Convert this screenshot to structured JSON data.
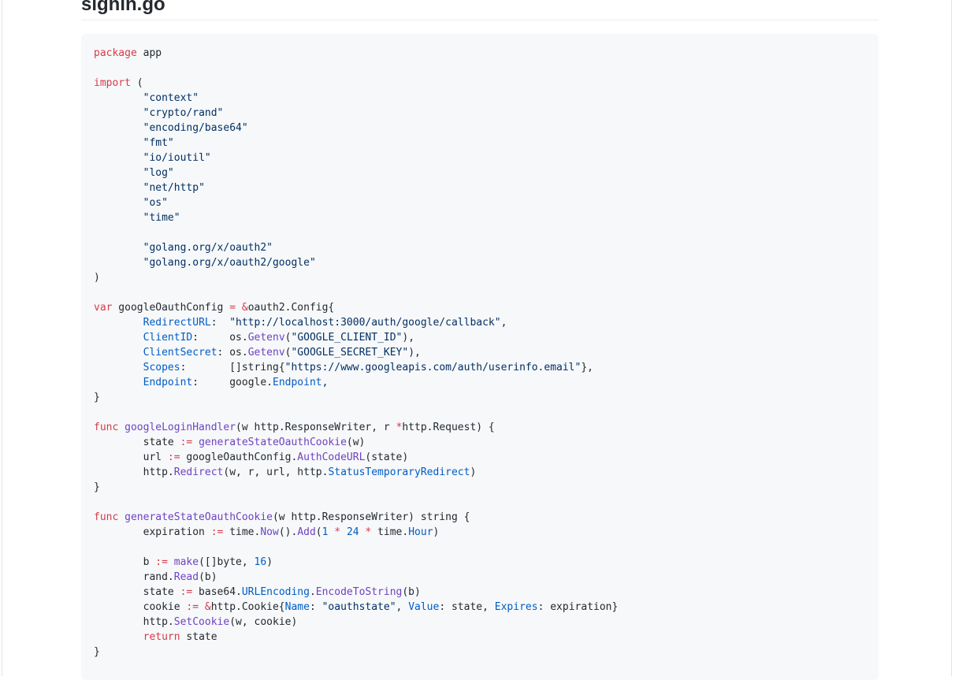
{
  "file": {
    "title": "signin.go"
  },
  "colors": {
    "keyword": "#d73a49",
    "string": "#032f62",
    "function": "#6f42c1",
    "field": "#005cc5",
    "text": "#24292e",
    "code_bg": "#f6f8fa"
  },
  "code_lines": [
    [
      [
        "kw",
        "package"
      ],
      [
        "plain",
        " app"
      ]
    ],
    [],
    [
      [
        "kw",
        "import"
      ],
      [
        "plain",
        " ("
      ]
    ],
    [
      [
        "plain",
        "        "
      ],
      [
        "str",
        "\"context\""
      ]
    ],
    [
      [
        "plain",
        "        "
      ],
      [
        "str",
        "\"crypto/rand\""
      ]
    ],
    [
      [
        "plain",
        "        "
      ],
      [
        "str",
        "\"encoding/base64\""
      ]
    ],
    [
      [
        "plain",
        "        "
      ],
      [
        "str",
        "\"fmt\""
      ]
    ],
    [
      [
        "plain",
        "        "
      ],
      [
        "str",
        "\"io/ioutil\""
      ]
    ],
    [
      [
        "plain",
        "        "
      ],
      [
        "str",
        "\"log\""
      ]
    ],
    [
      [
        "plain",
        "        "
      ],
      [
        "str",
        "\"net/http\""
      ]
    ],
    [
      [
        "plain",
        "        "
      ],
      [
        "str",
        "\"os\""
      ]
    ],
    [
      [
        "plain",
        "        "
      ],
      [
        "str",
        "\"time\""
      ]
    ],
    [],
    [
      [
        "plain",
        "        "
      ],
      [
        "str",
        "\"golang.org/x/oauth2\""
      ]
    ],
    [
      [
        "plain",
        "        "
      ],
      [
        "str",
        "\"golang.org/x/oauth2/google\""
      ]
    ],
    [
      [
        "plain",
        ")"
      ]
    ],
    [],
    [
      [
        "kw",
        "var"
      ],
      [
        "plain",
        " googleOauthConfig "
      ],
      [
        "op",
        "="
      ],
      [
        "plain",
        " "
      ],
      [
        "op",
        "&"
      ],
      [
        "plain",
        "oauth2.Config{"
      ]
    ],
    [
      [
        "plain",
        "        "
      ],
      [
        "field",
        "RedirectURL"
      ],
      [
        "plain",
        ":  "
      ],
      [
        "str",
        "\"http://localhost:3000/auth/google/callback\""
      ],
      [
        "plain",
        ","
      ]
    ],
    [
      [
        "plain",
        "        "
      ],
      [
        "field",
        "ClientID"
      ],
      [
        "plain",
        ":     os."
      ],
      [
        "fn",
        "Getenv"
      ],
      [
        "plain",
        "("
      ],
      [
        "str",
        "\"GOOGLE_CLIENT_ID\""
      ],
      [
        "plain",
        "),"
      ]
    ],
    [
      [
        "plain",
        "        "
      ],
      [
        "field",
        "ClientSecret"
      ],
      [
        "plain",
        ": os."
      ],
      [
        "fn",
        "Getenv"
      ],
      [
        "plain",
        "("
      ],
      [
        "str",
        "\"GOOGLE_SECRET_KEY\""
      ],
      [
        "plain",
        "),"
      ]
    ],
    [
      [
        "plain",
        "        "
      ],
      [
        "field",
        "Scopes"
      ],
      [
        "plain",
        ":       []string{"
      ],
      [
        "str",
        "\"https://www.googleapis.com/auth/userinfo.email\""
      ],
      [
        "plain",
        "},"
      ]
    ],
    [
      [
        "plain",
        "        "
      ],
      [
        "field",
        "Endpoint"
      ],
      [
        "plain",
        ":     google."
      ],
      [
        "field",
        "Endpoint"
      ],
      [
        "plain",
        ","
      ]
    ],
    [
      [
        "plain",
        "}"
      ]
    ],
    [],
    [
      [
        "kw",
        "func"
      ],
      [
        "plain",
        " "
      ],
      [
        "fn",
        "googleLoginHandler"
      ],
      [
        "plain",
        "(w http.ResponseWriter, r "
      ],
      [
        "op",
        "*"
      ],
      [
        "plain",
        "http.Request) {"
      ]
    ],
    [
      [
        "plain",
        "        state "
      ],
      [
        "op",
        ":="
      ],
      [
        "plain",
        " "
      ],
      [
        "fn",
        "generateStateOauthCookie"
      ],
      [
        "plain",
        "(w)"
      ]
    ],
    [
      [
        "plain",
        "        url "
      ],
      [
        "op",
        ":="
      ],
      [
        "plain",
        " googleOauthConfig."
      ],
      [
        "fn",
        "AuthCodeURL"
      ],
      [
        "plain",
        "(state)"
      ]
    ],
    [
      [
        "plain",
        "        http."
      ],
      [
        "fn",
        "Redirect"
      ],
      [
        "plain",
        "(w, r, url, http."
      ],
      [
        "field",
        "StatusTemporaryRedirect"
      ],
      [
        "plain",
        ")"
      ]
    ],
    [
      [
        "plain",
        "}"
      ]
    ],
    [],
    [
      [
        "kw",
        "func"
      ],
      [
        "plain",
        " "
      ],
      [
        "fn",
        "generateStateOauthCookie"
      ],
      [
        "plain",
        "(w http.ResponseWriter) string {"
      ]
    ],
    [
      [
        "plain",
        "        expiration "
      ],
      [
        "op",
        ":="
      ],
      [
        "plain",
        " time."
      ],
      [
        "fn",
        "Now"
      ],
      [
        "plain",
        "()."
      ],
      [
        "fn",
        "Add"
      ],
      [
        "plain",
        "("
      ],
      [
        "num",
        "1"
      ],
      [
        "plain",
        " "
      ],
      [
        "op",
        "*"
      ],
      [
        "plain",
        " "
      ],
      [
        "num",
        "24"
      ],
      [
        "plain",
        " "
      ],
      [
        "op",
        "*"
      ],
      [
        "plain",
        " time."
      ],
      [
        "field",
        "Hour"
      ],
      [
        "plain",
        ")"
      ]
    ],
    [],
    [
      [
        "plain",
        "        b "
      ],
      [
        "op",
        ":="
      ],
      [
        "plain",
        " "
      ],
      [
        "fn",
        "make"
      ],
      [
        "plain",
        "([]byte, "
      ],
      [
        "num",
        "16"
      ],
      [
        "plain",
        ")"
      ]
    ],
    [
      [
        "plain",
        "        rand."
      ],
      [
        "fn",
        "Read"
      ],
      [
        "plain",
        "(b)"
      ]
    ],
    [
      [
        "plain",
        "        state "
      ],
      [
        "op",
        ":="
      ],
      [
        "plain",
        " base64."
      ],
      [
        "field",
        "URLEncoding"
      ],
      [
        "plain",
        "."
      ],
      [
        "fn",
        "EncodeToString"
      ],
      [
        "plain",
        "(b)"
      ]
    ],
    [
      [
        "plain",
        "        cookie "
      ],
      [
        "op",
        ":="
      ],
      [
        "plain",
        " "
      ],
      [
        "op",
        "&"
      ],
      [
        "plain",
        "http.Cookie{"
      ],
      [
        "field",
        "Name"
      ],
      [
        "plain",
        ": "
      ],
      [
        "str",
        "\"oauthstate\""
      ],
      [
        "plain",
        ", "
      ],
      [
        "field",
        "Value"
      ],
      [
        "plain",
        ": state, "
      ],
      [
        "field",
        "Expires"
      ],
      [
        "plain",
        ": expiration}"
      ]
    ],
    [
      [
        "plain",
        "        http."
      ],
      [
        "fn",
        "SetCookie"
      ],
      [
        "plain",
        "(w, cookie)"
      ]
    ],
    [
      [
        "plain",
        "        "
      ],
      [
        "kw",
        "return"
      ],
      [
        "plain",
        " state"
      ]
    ],
    [
      [
        "plain",
        "}"
      ]
    ]
  ]
}
